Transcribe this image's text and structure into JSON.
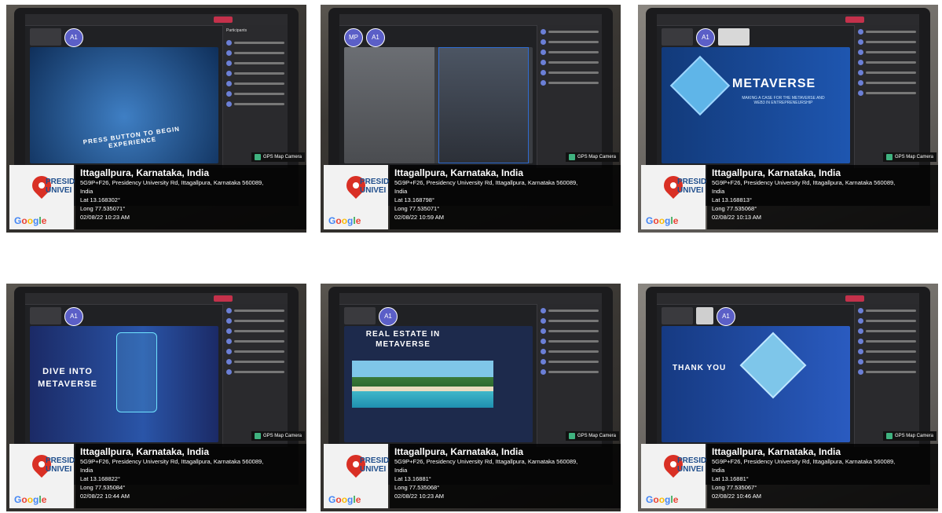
{
  "photos": [
    {
      "place": "Ittagallpura, Karnataka, India",
      "address": "5G9P+F26, Presidency University Rd, Ittagallpura, Karnataka 560089,",
      "country": "India",
      "lat": "Lat 13.168302°",
      "long": "Long 77.535071°",
      "datetime": "02/08/22 10:23 AM",
      "slide_title": "PRESS BUTTON TO BEGIN EXPERIENCE",
      "slide_sub": "",
      "stage_color": "#1a4f8a",
      "tile_label": "Participants"
    },
    {
      "place": "Ittagallpura, Karnataka, India",
      "address": "5G9P+F26, Presidency University Rd, Ittagallpura, Karnataka 560089,",
      "country": "India",
      "lat": "Lat 13.168798°",
      "long": "Long 77.535071°",
      "datetime": "02/08/22 10:59 AM",
      "slide_title": "",
      "slide_sub": "",
      "stage_color": "#33373d",
      "tile_label": ""
    },
    {
      "place": "Ittagallpura, Karnataka, India",
      "address": "5G9P+F26, Presidency University Rd, Ittagallpura, Karnataka 560089,",
      "country": "India",
      "lat": "Lat 13.168813°",
      "long": "Long 77.535068°",
      "datetime": "02/08/22 10:13 AM",
      "slide_title": "METAVERSE",
      "slide_sub": "MAKING A CASE FOR THE METAVERSE AND WEB3 IN ENTREPRENEURSHIP",
      "stage_color": "#1c3e7a",
      "tile_label": ""
    },
    {
      "place": "Ittagallpura, Karnataka, India",
      "address": "5G9P+F26, Presidency University Rd, Ittagallpura, Karnataka 560089,",
      "country": "India",
      "lat": "Lat 13.168822°",
      "long": "Long 77.535084°",
      "datetime": "02/08/22 10:44 AM",
      "slide_title": "DIVE INTO METAVERSE",
      "slide_sub": "",
      "stage_color": "#1b2e6e",
      "tile_label": ""
    },
    {
      "place": "Ittagallpura, Karnataka, India",
      "address": "5G9P+F26, Presidency University Rd, Ittagallpura, Karnataka 560089,",
      "country": "India",
      "lat": "Lat 13.16881°",
      "long": "Long 77.535068°",
      "datetime": "02/08/22 10:23 AM",
      "slide_title": "REAL ESTATE IN METAVERSE",
      "slide_sub": "",
      "stage_color": "#1d2a4c",
      "tile_label": ""
    },
    {
      "place": "Ittagallpura, Karnataka, India",
      "address": "5G9P+F26, Presidency University Rd, Ittagallpura, Karnataka 560089,",
      "country": "India",
      "lat": "Lat 13.16881°",
      "long": "Long 77.535067°",
      "datetime": "02/08/22 10:46 AM",
      "slide_title": "THANK YOU",
      "slide_sub": "",
      "stage_color": "#1b3f86",
      "tile_label": ""
    }
  ],
  "common": {
    "gps_badge": "GPS Map Camera",
    "university_logo": "PRESID UNIVEI",
    "google_letters": [
      "G",
      "o",
      "o",
      "g",
      "l",
      "e"
    ],
    "avatar_initials": "A1",
    "icons": [
      "map-pin-icon",
      "gps-camera-icon",
      "google-logo"
    ]
  }
}
